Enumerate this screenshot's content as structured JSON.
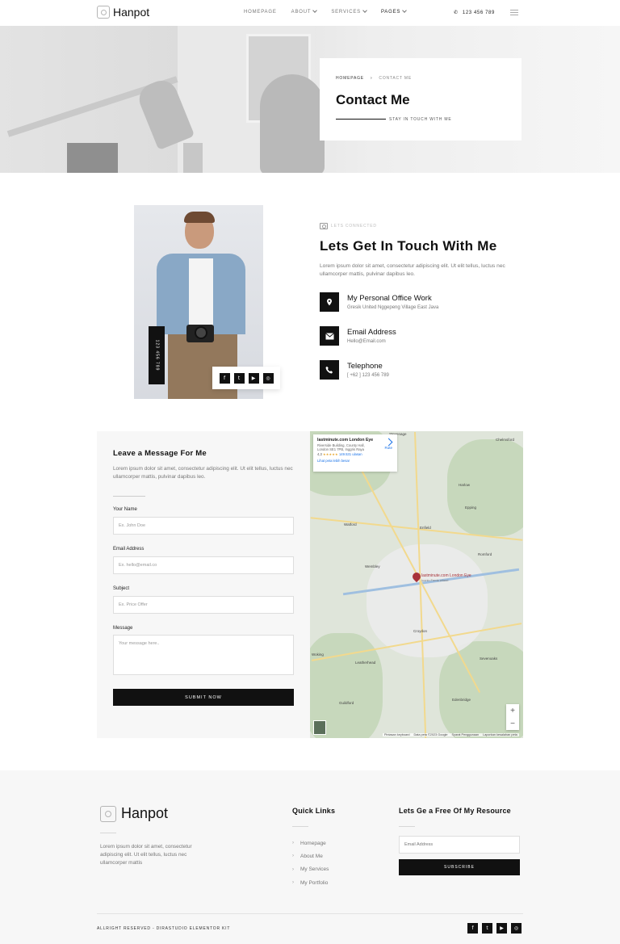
{
  "brand": {
    "name": "Hanpot"
  },
  "nav": {
    "items": [
      {
        "label": "HOMEPAGE",
        "has_dropdown": false
      },
      {
        "label": "ABOUT",
        "has_dropdown": true
      },
      {
        "label": "SERVICES",
        "has_dropdown": true
      },
      {
        "label": "PAGES",
        "has_dropdown": true
      }
    ],
    "phone": "123 456 789"
  },
  "hero": {
    "breadcrumb": {
      "home": "HOMEPAGE",
      "current": "CONTACT ME"
    },
    "title": "Contact Me",
    "subtitle": "STAY IN TOUCH WITH ME"
  },
  "about": {
    "portrait_phone": "123 456 789",
    "kicker": "LETS CONNECTED",
    "title": "Lets Get In Touch With Me",
    "description": "Lorem ipsum dolor sit amet, consectetur adipiscing elit. Ut elit tellus, luctus nec ullamcorper mattis, pulvinar dapibus leo.",
    "info": [
      {
        "title": "My Personal Office Work",
        "value": "Gresik United Nggepeng Village East Java",
        "icon": "map-pin-icon"
      },
      {
        "title": "Email Address",
        "value": "Hello@Email.com",
        "icon": "envelope-icon"
      },
      {
        "title": "Telephone",
        "value": "[ +62 ] 123 456 789",
        "icon": "phone-icon"
      }
    ]
  },
  "form": {
    "title": "Leave a Message For Me",
    "description": "Lorem ipsum dolor sit amet, consectetur adipiscing elit. Ut elit tellus, luctus nec ullamcorper mattis, pulvinar dapibus leo.",
    "fields": {
      "name": {
        "label": "Your Name",
        "placeholder": "Ex. John Doe"
      },
      "email": {
        "label": "Email Address",
        "placeholder": "Ex. hello@email.co"
      },
      "subject": {
        "label": "Subject",
        "placeholder": "Ex. Price Offer"
      },
      "message": {
        "label": "Message",
        "placeholder": "Your message here.."
      }
    },
    "submit_label": "SUBMIT NOW"
  },
  "map": {
    "place_title": "lastminute.com London Eye",
    "address": "Riverside Building, County Hall, London SE1 7PB, Inggris Raya",
    "rating": "4,3",
    "stars": "★★★★★",
    "reviews": "149.531 ulasan",
    "link": "Lihat peta lebih besar",
    "directions": "Rute",
    "pin_label": "lastminute.com London Eye",
    "pin_sub": "Iconic Ferris wheel",
    "places": [
      "Stevenage",
      "Harlow",
      "Watford",
      "Enfield",
      "Wembley",
      "Romford",
      "Croydon",
      "Sevenoaks",
      "Epping",
      "Guildford",
      "Woking",
      "Leatherhead",
      "Edenbridge",
      "Chelmsford"
    ],
    "zoom_in": "+",
    "zoom_out": "−",
    "attribution": [
      "Pintasan keyboard",
      "Data peta ©2023 Google",
      "Syarat Penggunaan",
      "Laporkan kesalahan peta"
    ]
  },
  "footer": {
    "brand": "Hanpot",
    "description": "Lorem ipsum dolor sit amet, consectetur adipiscing elit. Ut elit tellus, luctus nec ullamcorper mattis",
    "links_title": "Quick Links",
    "links": [
      "Homepage",
      "About Me",
      "My Services",
      "My Portfolio"
    ],
    "resource_title": "Lets Ge a Free Of My Resource",
    "email_placeholder": "Email Address",
    "subscribe_label": "SUBSCRIBE",
    "copyright": "ALLRIGHT RESERVED - DIRASTUDIO ELEMENTOR KIT"
  },
  "social": [
    {
      "name": "facebook-icon",
      "glyph": "f"
    },
    {
      "name": "twitter-icon",
      "glyph": "t"
    },
    {
      "name": "youtube-icon",
      "glyph": "▶"
    },
    {
      "name": "instagram-icon",
      "glyph": "◎"
    }
  ],
  "colors": {
    "primary": "#111111",
    "muted": "#777777",
    "panel": "#f7f7f7",
    "pin": "#a8323a"
  }
}
